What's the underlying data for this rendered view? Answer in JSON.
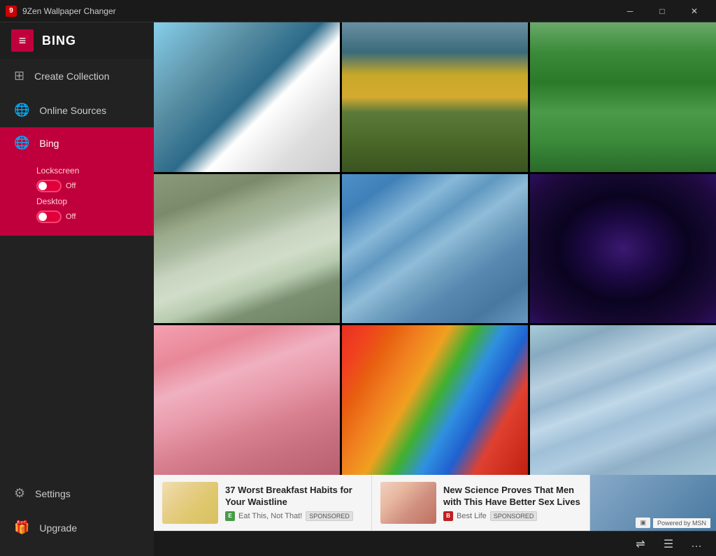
{
  "app": {
    "title": "9Zen Wallpaper Changer"
  },
  "titlebar": {
    "minimize_label": "─",
    "maximize_label": "□",
    "close_label": "✕"
  },
  "sidebar": {
    "hamburger": "≡",
    "brand": "BING",
    "nav": {
      "create_collection": "Create Collection",
      "online_sources": "Online Sources",
      "bing": "Bing",
      "settings": "Settings",
      "upgrade": "Upgrade"
    },
    "bing_controls": {
      "lockscreen_label": "Lockscreen",
      "lockscreen_state": "Off",
      "desktop_label": "Desktop",
      "desktop_state": "Off"
    }
  },
  "wallpapers": [
    {
      "id": "pelican",
      "alt": "White pelican in flight"
    },
    {
      "id": "river",
      "alt": "Autumn river with horses"
    },
    {
      "id": "forest",
      "alt": "Green pine forest"
    },
    {
      "id": "waterfall",
      "alt": "Waterfall on mossy rocks"
    },
    {
      "id": "glacier-blue",
      "alt": "Blue glacier canyon with plane"
    },
    {
      "id": "night-sky",
      "alt": "Night sky with stars"
    },
    {
      "id": "cherry",
      "alt": "Cherry blossom trees"
    },
    {
      "id": "feathers",
      "alt": "Colorful parrot feathers"
    },
    {
      "id": "ice",
      "alt": "Blue ice glacier"
    }
  ],
  "ads": [
    {
      "id": "ad1",
      "title": "37 Worst Breakfast Habits for Your Waistline",
      "source_name": "Eat This, Not That!",
      "source_badge_text": "SPONSORED",
      "source_color": "green"
    },
    {
      "id": "ad2",
      "title": "New Science Proves That Men with This Have Better Sex Lives",
      "source_name": "Best Life",
      "source_badge_text": "SPONSORED",
      "source_color": "red"
    }
  ],
  "msn": {
    "powered_by": "Powered by MSN"
  },
  "status_bar": {
    "icon1": "⇌",
    "icon2": "☰",
    "icon3": "…"
  }
}
